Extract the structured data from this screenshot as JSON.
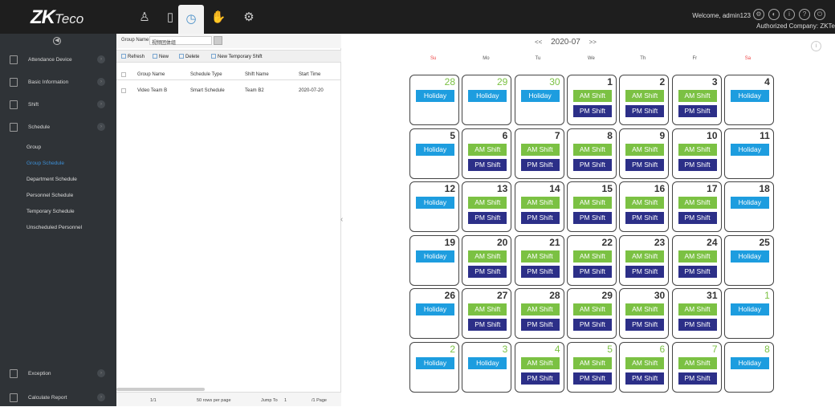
{
  "app": {
    "logo_main": "ZK",
    "logo_sub": "Teco",
    "welcome": "Welcome, admin123",
    "company": "Authorized Company: ZKTe"
  },
  "topnav": [
    {
      "icon": "person-icon",
      "glyph": "♙",
      "active": false
    },
    {
      "icon": "device-icon",
      "glyph": "▯",
      "active": false
    },
    {
      "icon": "clock-icon",
      "glyph": "◷",
      "active": true
    },
    {
      "icon": "hand-icon",
      "glyph": "✋",
      "active": false
    },
    {
      "icon": "gear-icon",
      "glyph": "⚙",
      "active": false
    }
  ],
  "sidebar": {
    "collapse_glyph": "◀",
    "menus": [
      {
        "label": "Attendance Device",
        "icon": "monitor-icon"
      },
      {
        "label": "Basic Information",
        "icon": "globe-icon"
      },
      {
        "label": "Shift",
        "icon": "calendar-icon"
      },
      {
        "label": "Schedule",
        "icon": "schedule-icon"
      }
    ],
    "subitems": [
      "Group",
      "Group Schedule",
      "Department Schedule",
      "Personnel Schedule",
      "Temporary Schedule",
      "Unscheduled Personnel"
    ],
    "bottom_menus": [
      {
        "label": "Exception",
        "icon": "exception-icon"
      },
      {
        "label": "Calculate Report",
        "icon": "report-icon"
      }
    ]
  },
  "leftpanel": {
    "group_name_label": "Group Name",
    "group_name_value": "视频团体组",
    "toolbar": {
      "refresh": "Refresh",
      "new": "New",
      "delete": "Delete",
      "new_temp": "New Temporary Shift"
    },
    "columns": [
      "Group Name",
      "Schedule Type",
      "Shift Name",
      "Start Time"
    ],
    "rows": [
      [
        "Video Team B",
        "Smart Schedule",
        "Team B2",
        "2020-07-20"
      ]
    ],
    "footer": {
      "page": "1/1",
      "rows_per_page": "50 rows per page",
      "jump_to": "Jump To",
      "jump_value": "1",
      "pages": "/1 Page"
    }
  },
  "calendar": {
    "prev": "<<",
    "month": "2020-07",
    "next": ">>",
    "weekdays": [
      "Su",
      "Mo",
      "Tu",
      "We",
      "Th",
      "Fr",
      "Sa"
    ],
    "holiday_label": "Holiday",
    "am_label": "AM Shift",
    "pm_label": "PM Shift",
    "weeks": [
      [
        {
          "d": "28",
          "o": true,
          "s": "H"
        },
        {
          "d": "29",
          "o": true,
          "s": "H"
        },
        {
          "d": "30",
          "o": true,
          "s": "H"
        },
        {
          "d": "1",
          "s": "S"
        },
        {
          "d": "2",
          "s": "S"
        },
        {
          "d": "3",
          "s": "S"
        },
        {
          "d": "4",
          "s": "H"
        }
      ],
      [
        {
          "d": "5",
          "s": "H"
        },
        {
          "d": "6",
          "s": "S"
        },
        {
          "d": "7",
          "s": "S"
        },
        {
          "d": "8",
          "s": "S"
        },
        {
          "d": "9",
          "s": "S"
        },
        {
          "d": "10",
          "s": "S"
        },
        {
          "d": "11",
          "s": "H"
        }
      ],
      [
        {
          "d": "12",
          "s": "H"
        },
        {
          "d": "13",
          "s": "S"
        },
        {
          "d": "14",
          "s": "S"
        },
        {
          "d": "15",
          "s": "S"
        },
        {
          "d": "16",
          "s": "S"
        },
        {
          "d": "17",
          "s": "S"
        },
        {
          "d": "18",
          "s": "H"
        }
      ],
      [
        {
          "d": "19",
          "s": "H"
        },
        {
          "d": "20",
          "s": "S"
        },
        {
          "d": "21",
          "s": "S"
        },
        {
          "d": "22",
          "s": "S"
        },
        {
          "d": "23",
          "s": "S"
        },
        {
          "d": "24",
          "s": "S"
        },
        {
          "d": "25",
          "s": "H"
        }
      ],
      [
        {
          "d": "26",
          "s": "H"
        },
        {
          "d": "27",
          "s": "S"
        },
        {
          "d": "28",
          "s": "S"
        },
        {
          "d": "29",
          "s": "S"
        },
        {
          "d": "30",
          "s": "S"
        },
        {
          "d": "31",
          "s": "S"
        },
        {
          "d": "1",
          "o": true,
          "s": "H"
        }
      ],
      [
        {
          "d": "2",
          "o": true,
          "s": "H"
        },
        {
          "d": "3",
          "o": true,
          "s": "H"
        },
        {
          "d": "4",
          "o": true,
          "s": "S"
        },
        {
          "d": "5",
          "o": true,
          "s": "S"
        },
        {
          "d": "6",
          "o": true,
          "s": "S"
        },
        {
          "d": "7",
          "o": true,
          "s": "S"
        },
        {
          "d": "8",
          "o": true,
          "s": "H"
        }
      ]
    ]
  }
}
